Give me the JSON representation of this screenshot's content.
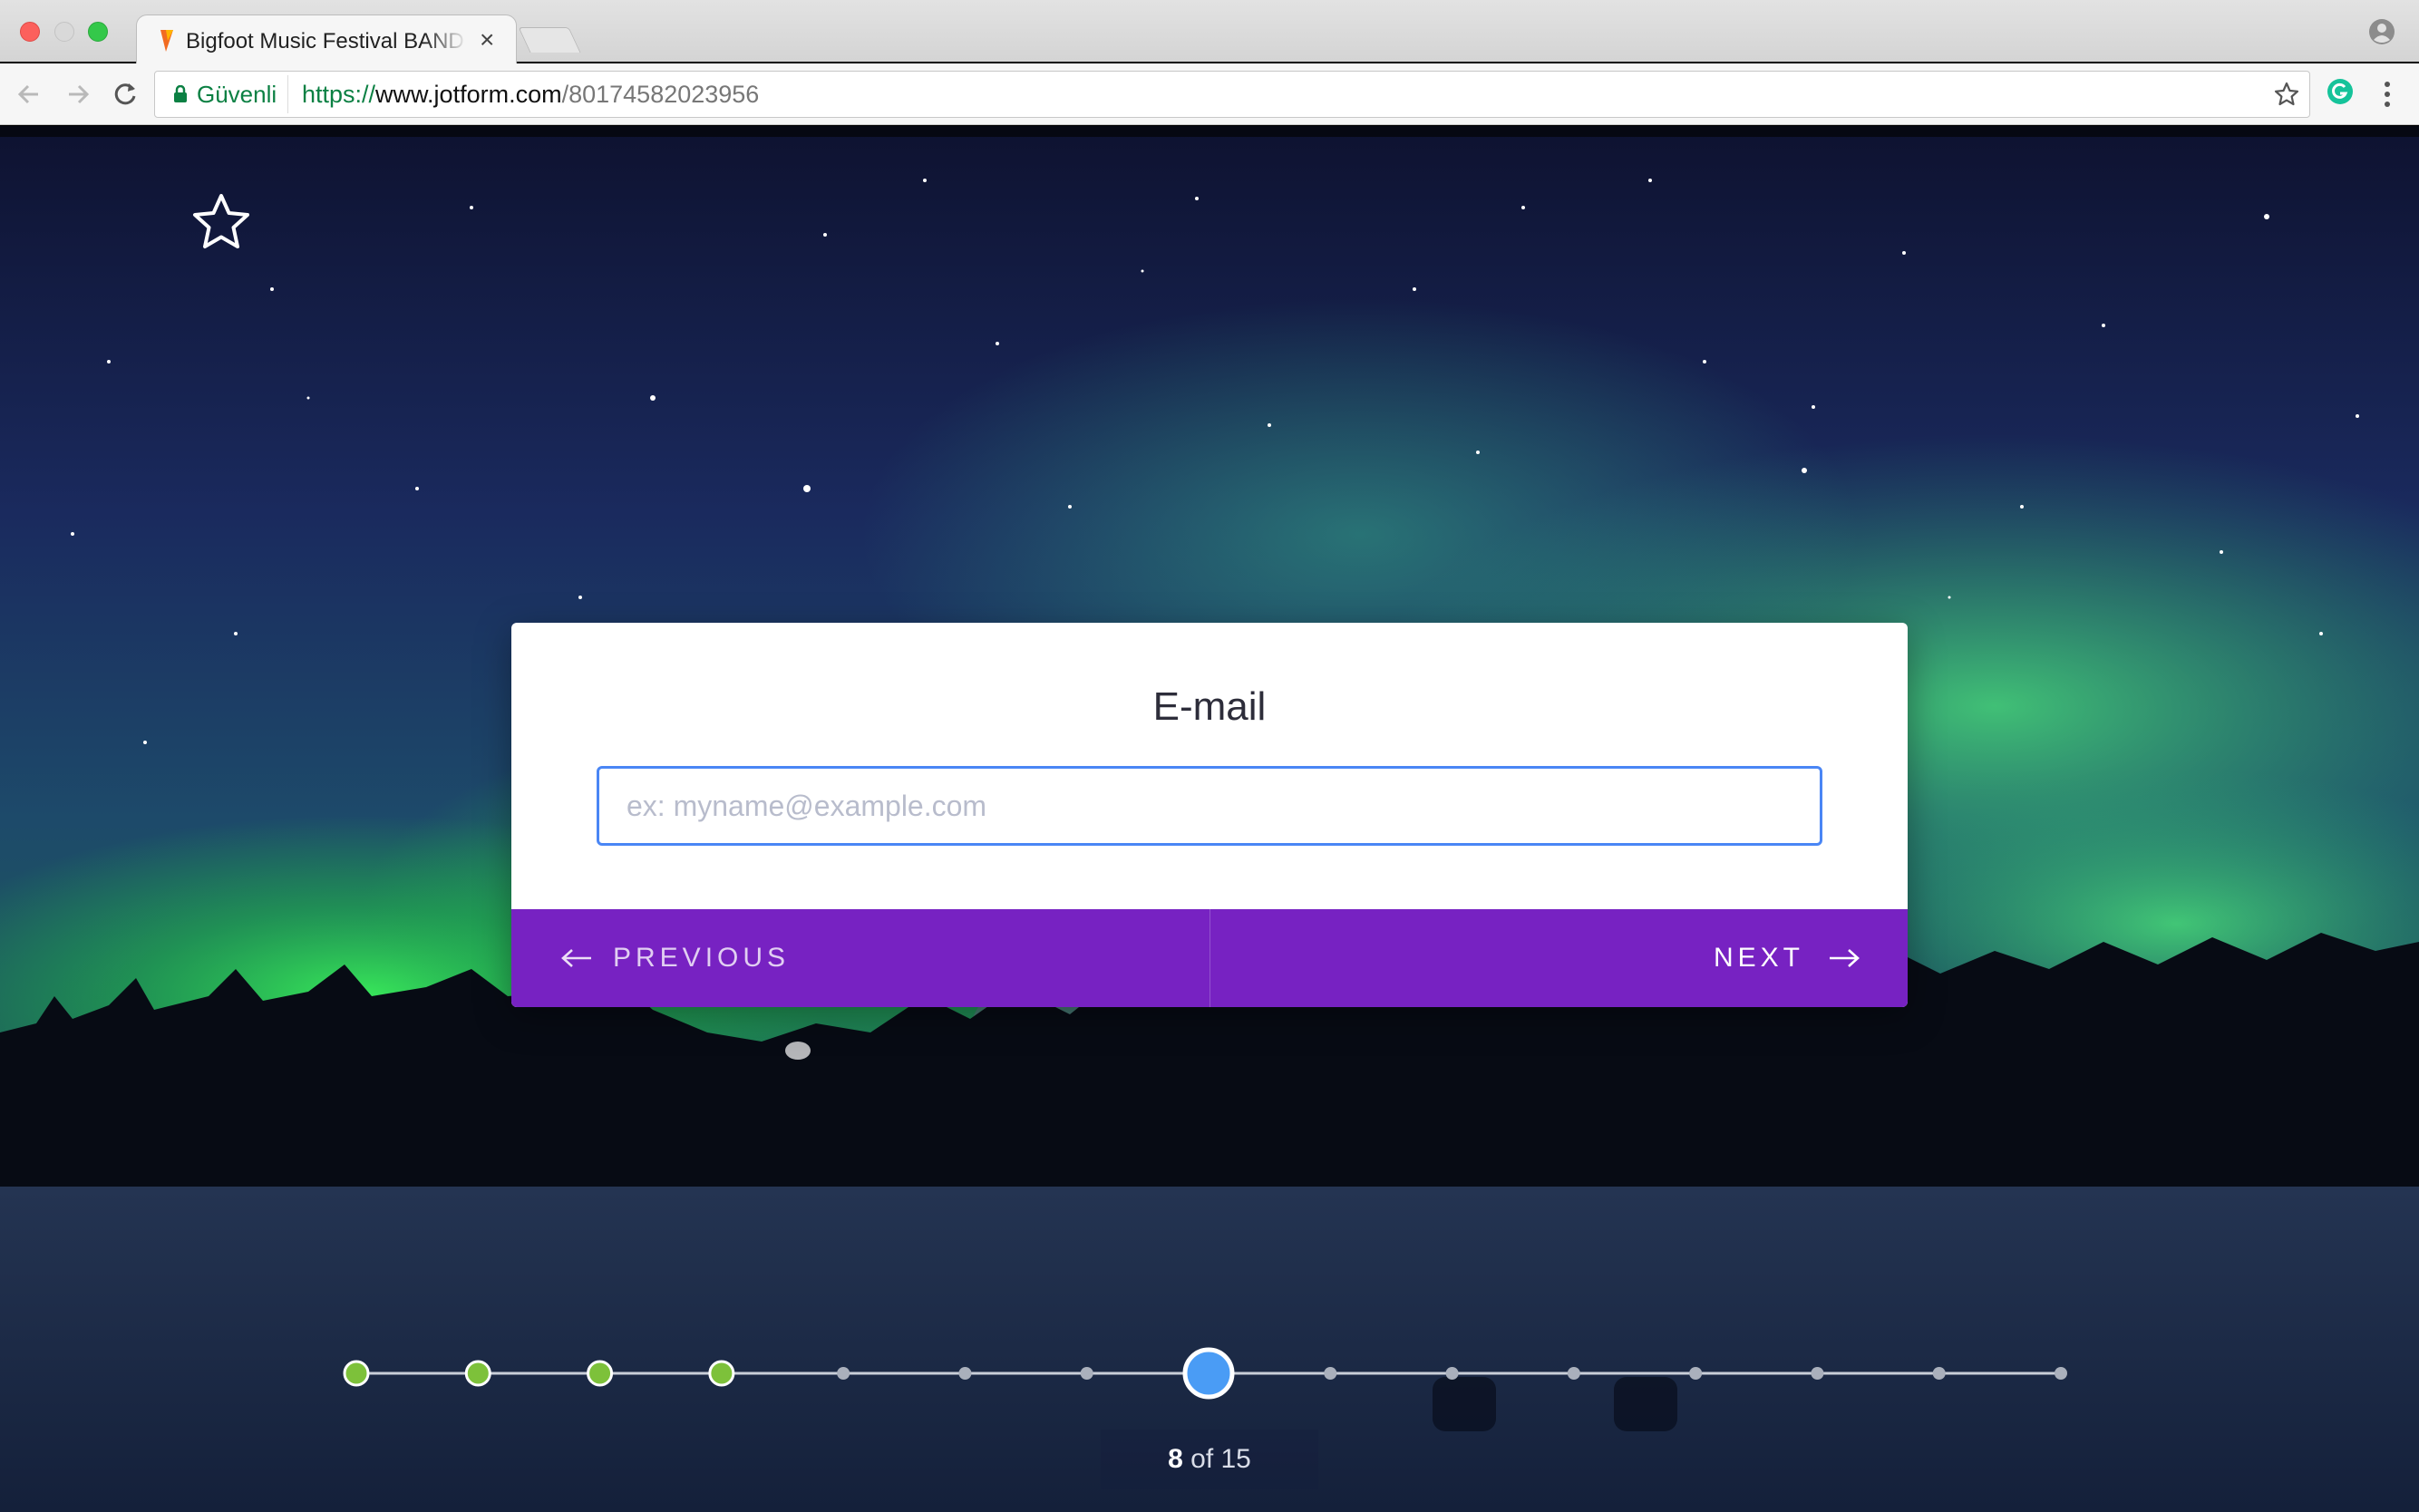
{
  "browser": {
    "tab_title": "Bigfoot Music Festival BAND A",
    "tab_close": "×",
    "secure_label": "Güvenli",
    "url_scheme": "https://",
    "url_host": "www.jotform.com",
    "url_path": "/80174582023956"
  },
  "form": {
    "question_title": "E-mail",
    "email_placeholder": "ex: myname@example.com",
    "email_value": "",
    "previous_label": "PREVIOUS",
    "next_label": "NEXT"
  },
  "progress": {
    "current": 8,
    "total": 15,
    "completed": [
      1,
      2,
      3,
      4
    ],
    "counter_current": "8",
    "counter_rest": " of 15"
  },
  "colors": {
    "accent_purple": "#7722c2",
    "input_focus": "#4a86f5",
    "step_done": "#7dc13a",
    "step_current": "#4a9cf5"
  },
  "icons": {
    "favorite": "star-outline-icon",
    "previous": "arrow-left-icon",
    "next": "arrow-right-icon"
  }
}
